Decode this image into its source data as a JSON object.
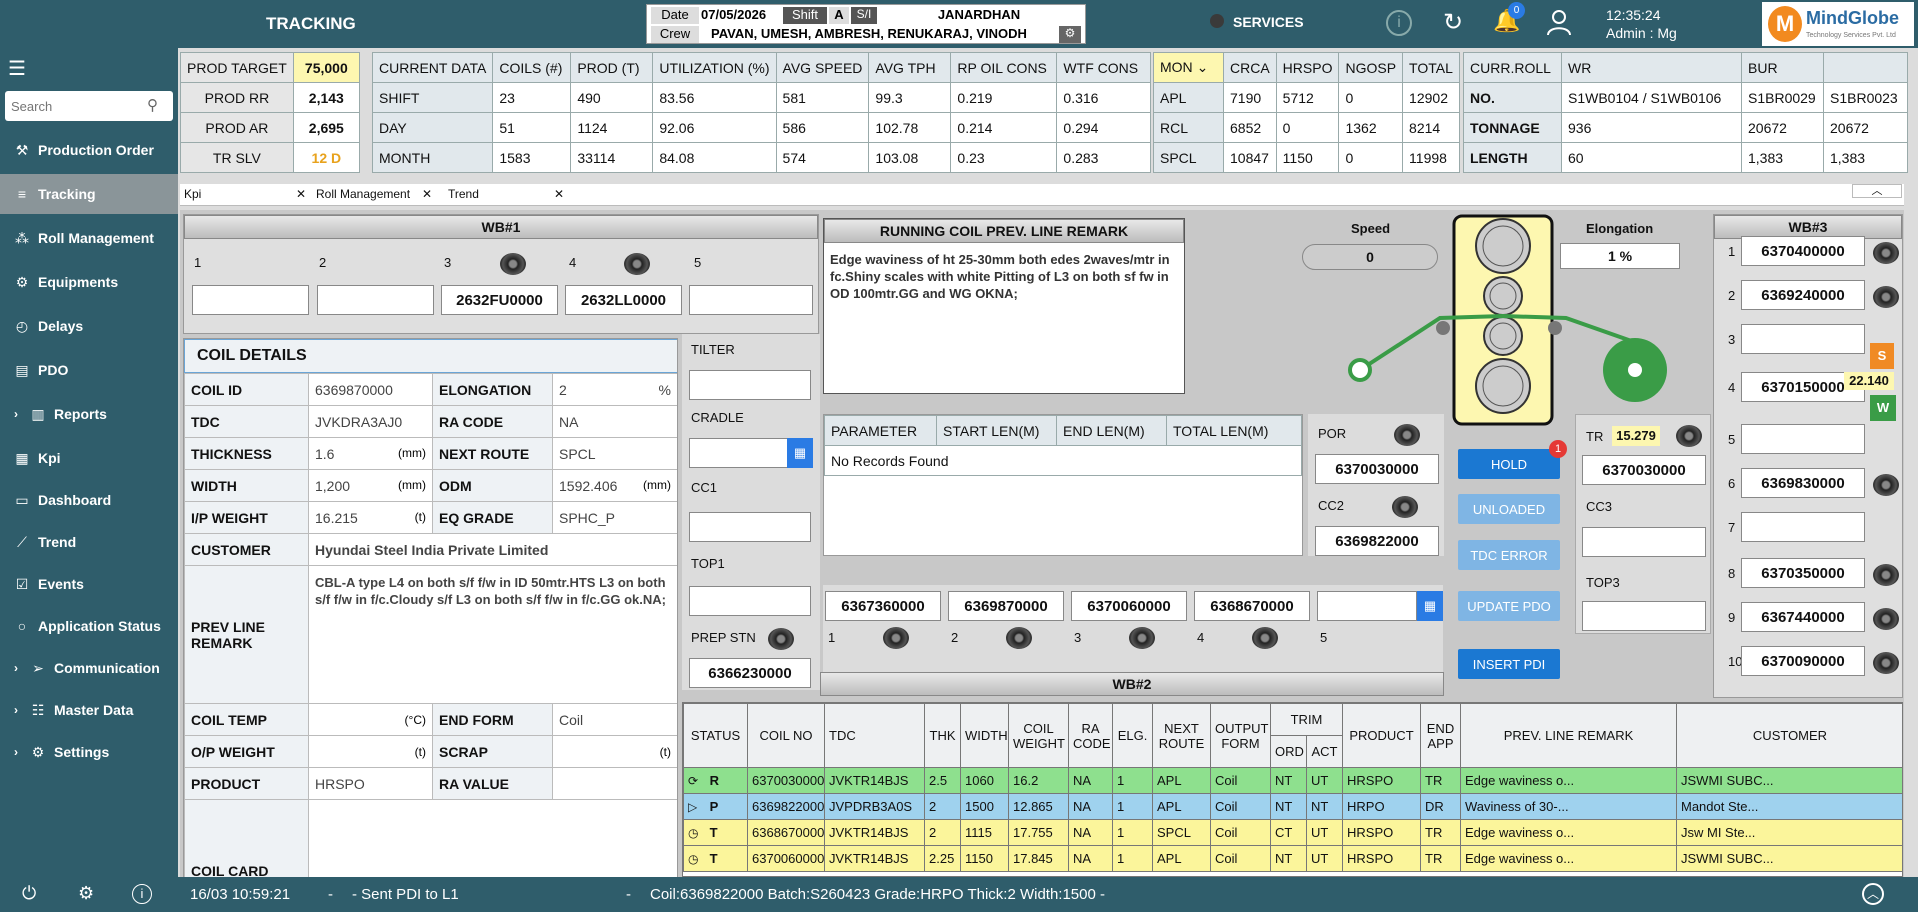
{
  "app": {
    "title": "TRACKING",
    "company": "MindGlobe",
    "company_sub": "Technology Services Pvt. Ltd"
  },
  "header": {
    "date_label": "Date",
    "date": "07/05/2026",
    "shift_label": "Shift",
    "shift": "A",
    "si_label": "S/I",
    "si_name": "JANARDHAN",
    "crew_label": "Crew",
    "crew": "PAVAN, UMESH, AMBRESH, RENUKARAJ, VINODH",
    "services": "SERVICES",
    "notif_count": "0",
    "time": "12:35:24",
    "user": "Admin : Mg"
  },
  "sidebar": {
    "search_placeholder": "Search",
    "items": [
      "Production Order",
      "Tracking",
      "Roll Management",
      "Equipments",
      "Delays",
      "PDO",
      "Reports",
      "Kpi",
      "Dashboard",
      "Trend",
      "Events",
      "Application Status",
      "Communication",
      "Master Data",
      "Settings"
    ]
  },
  "prod": {
    "rows": [
      [
        "PROD TARGET",
        "75,000"
      ],
      [
        "PROD RR",
        "2,143"
      ],
      [
        "PROD AR",
        "2,695"
      ],
      [
        "TR SLV",
        "12 D"
      ]
    ]
  },
  "current": {
    "headers": [
      "CURRENT DATA",
      "COILS (#)",
      "PROD (T)",
      "UTILIZATION (%)",
      "AVG SPEED",
      "AVG TPH",
      "RP OIL CONS",
      "WTF CONS"
    ],
    "rows": [
      [
        "SHIFT",
        "23",
        "490",
        "83.56",
        "581",
        "99.3",
        "0.219",
        "0.316"
      ],
      [
        "DAY",
        "51",
        "1124",
        "92.06",
        "586",
        "102.78",
        "0.214",
        "0.294"
      ],
      [
        "MONTH",
        "1583",
        "33114",
        "84.08",
        "574",
        "103.08",
        "0.23",
        "0.283"
      ]
    ]
  },
  "mon": {
    "headers": [
      "MON",
      "CRCA",
      "HRSPO",
      "NGOSP",
      "TOTAL"
    ],
    "rows": [
      [
        "APL",
        "7190",
        "5712",
        "0",
        "12902"
      ],
      [
        "RCL",
        "6852",
        "0",
        "1362",
        "8214"
      ],
      [
        "SPCL",
        "10847",
        "1150",
        "0",
        "11998"
      ]
    ]
  },
  "roll": {
    "headers": [
      "CURR.ROLL",
      "WR",
      "BUR",
      ""
    ],
    "rows": [
      [
        "NO.",
        "S1WB0104 / S1WB0106",
        "S1BR0029",
        "S1BR0023"
      ],
      [
        "TONNAGE",
        "936",
        "20672",
        "20672"
      ],
      [
        "LENGTH",
        "60",
        "1,383",
        "1,383"
      ]
    ]
  },
  "tabs": [
    "Kpi",
    "Roll Management",
    "Trend"
  ],
  "wb1": {
    "title": "WB#1",
    "labels": [
      "1",
      "2",
      "3",
      "4",
      "5"
    ],
    "values": [
      "",
      "",
      "2632FU0000",
      "2632LL0000",
      ""
    ]
  },
  "remark": {
    "title": "RUNNING COIL PREV. LINE REMARK",
    "text": "Edge waviness of ht 25-30mm both edes 2waves/mtr in fc.Shiny scales with white Pitting of L3 on both sf fw in OD 100mtr.GG and WG OKNA;"
  },
  "mill": {
    "speed_label": "Speed",
    "speed": "0",
    "elong_label": "Elongation",
    "elong": "1 %"
  },
  "wb3": {
    "title": "WB#3",
    "rows": [
      [
        "1",
        "6370400000"
      ],
      [
        "2",
        "6369240000"
      ],
      [
        "3",
        ""
      ],
      [
        "4",
        "6370150000"
      ],
      [
        "5",
        ""
      ],
      [
        "6",
        "6369830000"
      ],
      [
        "7",
        ""
      ],
      [
        "8",
        "6370350000"
      ],
      [
        "9",
        "6367440000"
      ],
      [
        "10",
        "6370090000"
      ]
    ],
    "badge_s": "S",
    "badge_val": "22.140",
    "badge_w": "W"
  },
  "coil": {
    "title": "COIL DETAILS",
    "coil_id_l": "COIL ID",
    "coil_id": "6369870000",
    "elong_l": "ELONGATION",
    "elong": "2",
    "elong_u": "%",
    "tdc_l": "TDC",
    "tdc": "JVKDRA3AJ0",
    "ra_l": "RA CODE",
    "ra": "NA",
    "thk_l": "THICKNESS",
    "thk": "1.6",
    "thk_u": "(mm)",
    "route_l": "NEXT ROUTE",
    "route": "SPCL",
    "width_l": "WIDTH",
    "width": "1,200",
    "width_u": "(mm)",
    "odm_l": "ODM",
    "odm": "1592.406",
    "odm_u": "(mm)",
    "ipw_l": "I/P WEIGHT",
    "ipw": "16.215",
    "ipw_u": "(t)",
    "eq_l": "EQ GRADE",
    "eq": "SPHC_P",
    "cust_l": "CUSTOMER",
    "cust": "Hyundai Steel India Private Limited",
    "prev_l": "PREV LINE REMARK",
    "prev": "CBL-A type L4 on both s/f f/w in ID 50mtr.HTS L3 on both s/f f/w in f/c.Cloudy s/f L3 on both s/f f/w in f/c.GG ok.NA;",
    "temp_l": "COIL TEMP",
    "temp_u": "(°C)",
    "end_l": "END FORM",
    "end": "Coil",
    "opw_l": "O/P WEIGHT",
    "opw_u": "(t)",
    "scrap_l": "SCRAP",
    "scrap_u": "(t)",
    "prod_l": "PRODUCT",
    "prod": "HRSPO",
    "rav_l": "RA VALUE",
    "card_l": "COIL CARD"
  },
  "left_stations": {
    "tilter": "TILTER",
    "cradle": "CRADLE",
    "cc1": "CC1",
    "top1": "TOP1",
    "prep": "PREP STN",
    "prep_val": "6366230000"
  },
  "param": {
    "headers": [
      "PARAMETER",
      "START LEN(M)",
      "END LEN(M)",
      "TOTAL LEN(M)"
    ],
    "empty": "No Records Found"
  },
  "por": {
    "por_l": "POR",
    "por": "6370030000",
    "cc2_l": "CC2",
    "cc2": "6369822000",
    "tr_l": "TR",
    "tr_val": "15.279",
    "tr": "6370030000",
    "cc3_l": "CC3",
    "top3_l": "TOP3"
  },
  "actions": {
    "hold": "HOLD",
    "hold_badge": "1",
    "unloaded": "UNLOADED",
    "tdc_error": "TDC ERROR",
    "update_pdo": "UPDATE PDO",
    "insert_pdi": "INSERT PDI"
  },
  "wb2": {
    "title": "WB#2",
    "values": [
      "6367360000",
      "6369870000",
      "6370060000",
      "6368670000",
      ""
    ],
    "labels": [
      "1",
      "2",
      "3",
      "4",
      "5"
    ]
  },
  "grid": {
    "headers": [
      "STATUS",
      "COIL NO",
      "TDC",
      "THK",
      "WIDTH",
      "COIL WEIGHT",
      "RA CODE",
      "ELG.",
      "NEXT ROUTE",
      "OUTPUT FORM",
      "TRIM",
      "PRODUCT",
      "END APP",
      "PREV. LINE REMARK",
      "CUSTOMER"
    ],
    "trim_sub": [
      "ORD",
      "ACT"
    ],
    "rows": [
      [
        "R",
        "6370030000",
        "JVKTR14BJS",
        "2.5",
        "1060",
        "16.2",
        "NA",
        "1",
        "APL",
        "Coil",
        "NT",
        "UT",
        "HRSPO",
        "TR",
        "Edge waviness o...",
        "JSWMI SUBC..."
      ],
      [
        "P",
        "6369822000",
        "JVPDRB3A0S",
        "2",
        "1500",
        "12.865",
        "NA",
        "1",
        "APL",
        "Coil",
        "NT",
        "NT",
        "HRPO",
        "DR",
        "Waviness of 30-...",
        "Mandot Ste..."
      ],
      [
        "T",
        "6368670000",
        "JVKTR14BJS",
        "2",
        "1115",
        "17.755",
        "NA",
        "1",
        "SPCL",
        "Coil",
        "CT",
        "UT",
        "HRSPO",
        "TR",
        "Edge waviness o...",
        "Jsw MI Ste..."
      ],
      [
        "T",
        "6370060000",
        "JVKTR14BJS",
        "2.25",
        "1150",
        "17.845",
        "NA",
        "1",
        "APL",
        "Coil",
        "NT",
        "UT",
        "HRSPO",
        "TR",
        "Edge waviness o...",
        "JSWMI SUBC..."
      ]
    ],
    "row_colors": [
      "#8ee08e",
      "#9fd2ee",
      "#fbf59b",
      "#fbf59b"
    ]
  },
  "status": {
    "time": "16/03 10:59:21",
    "sep1": "-",
    "msg": "- Sent PDI to L1",
    "sep2": "-",
    "coil": "Coil:6369822000 Batch:S260423 Grade:HRPO Thick:2 Width:1500 -"
  }
}
